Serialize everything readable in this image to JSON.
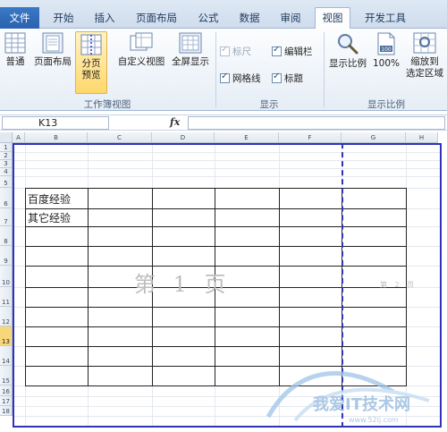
{
  "ribbon_tabs": {
    "file": "文件",
    "home": "开始",
    "insert": "插入",
    "page_layout": "页面布局",
    "formulas": "公式",
    "data": "数据",
    "review": "审阅",
    "view": "视图",
    "developer": "开发工具"
  },
  "workbook_views": {
    "normal": "普通",
    "page_layout": "页面布局",
    "page_break_preview_line1": "分页",
    "page_break_preview_line2": "预览",
    "custom_views": "自定义视图",
    "full_screen": "全屏显示",
    "group_label": "工作簿视图"
  },
  "show": {
    "ruler": "标尺",
    "formula_bar": "编辑栏",
    "gridlines": "网格线",
    "headings": "标题",
    "group_label": "显示"
  },
  "zoom": {
    "zoom": "显示比例",
    "hundred": "100%",
    "hundred_icon_text": "100",
    "to_selection_line1": "缩放到",
    "to_selection_line2": "选定区域",
    "group_label": "显示比例"
  },
  "formula_bar": {
    "name_box": "K13",
    "fx": "fx",
    "value": ""
  },
  "columns": [
    "A",
    "B",
    "C",
    "D",
    "E",
    "F",
    "G",
    "H"
  ],
  "rows": [
    "1",
    "2",
    "3",
    "4",
    "5",
    "6",
    "7",
    "8",
    "9",
    "10",
    "11",
    "12",
    "13",
    "14",
    "15",
    "16",
    "17",
    "18"
  ],
  "selected_row": "13",
  "cells": {
    "b6": "百度经验",
    "b7": "其它经验"
  },
  "page_labels": {
    "page1": "第 1 页",
    "page2": "第 2 页"
  },
  "site_watermark": {
    "text": "我爱IT技术网",
    "url": "www.52ij.com"
  }
}
